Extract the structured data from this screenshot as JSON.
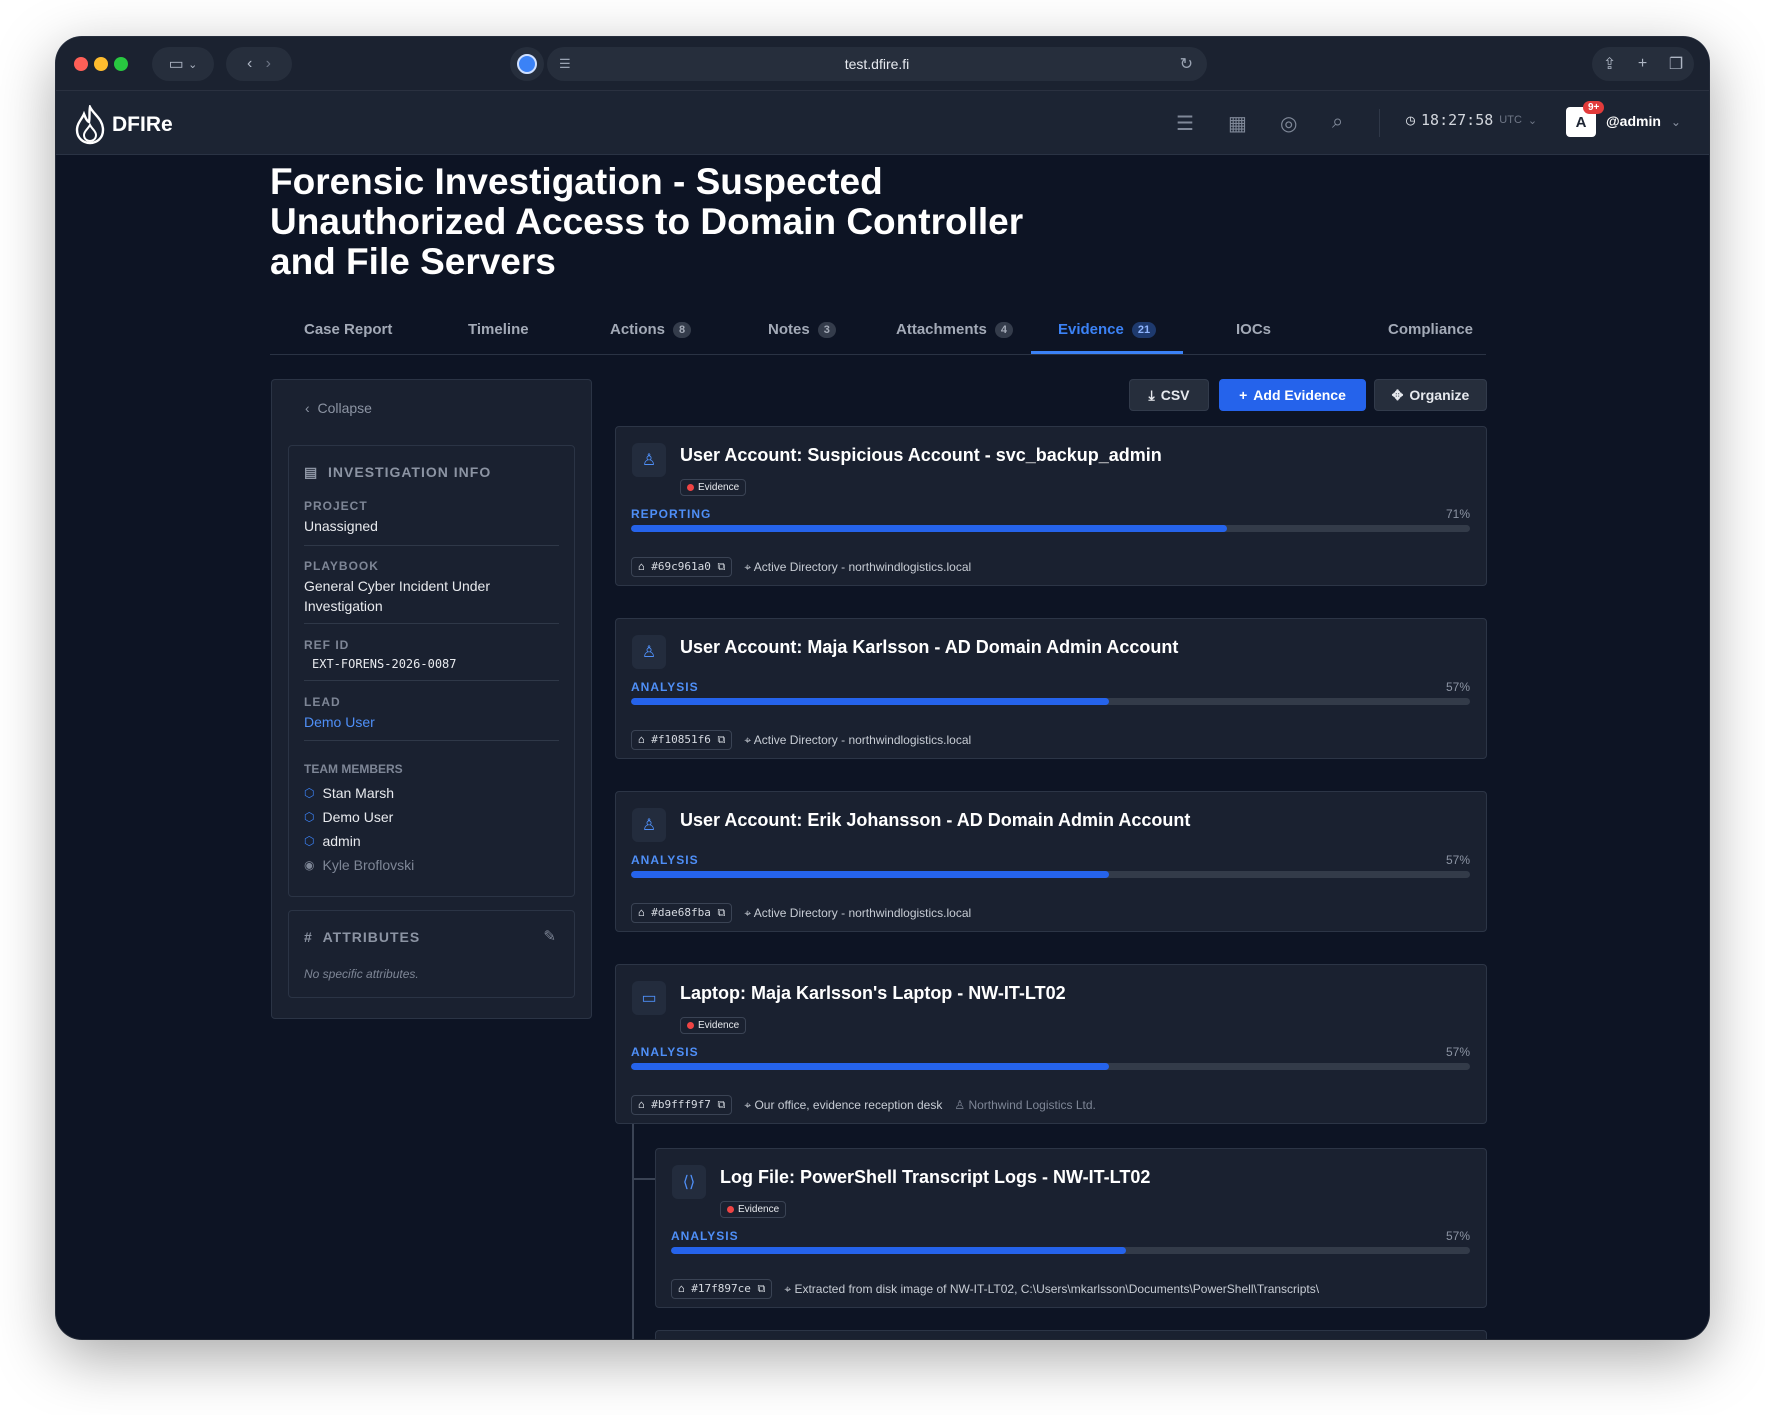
{
  "browser": {
    "url": "test.dfire.fi"
  },
  "header": {
    "app_name": "DFIRe",
    "time": "18:27:58",
    "timezone": "UTC",
    "notif_badge": "9+",
    "avatar_letter": "A",
    "username": "@admin"
  },
  "case": {
    "title": "Forensic Investigation - Suspected Unauthorized Access to Domain Controller and File Servers"
  },
  "tabs": [
    {
      "label": "Case Report",
      "count": ""
    },
    {
      "label": "Timeline",
      "count": ""
    },
    {
      "label": "Actions",
      "count": "8"
    },
    {
      "label": "Notes",
      "count": "3"
    },
    {
      "label": "Attachments",
      "count": "4"
    },
    {
      "label": "Evidence",
      "count": "21"
    },
    {
      "label": "IOCs",
      "count": ""
    },
    {
      "label": "Compliance",
      "count": ""
    }
  ],
  "sidebar": {
    "collapse": "Collapse",
    "info_title": "INVESTIGATION INFO",
    "project_label": "PROJECT",
    "project": "Unassigned",
    "playbook_label": "PLAYBOOK",
    "playbook": "General Cyber Incident Under Investigation",
    "refid_label": "REF ID",
    "refid": "EXT-FORENS-2026-0087",
    "lead_label": "LEAD",
    "lead": "Demo User",
    "team_label": "TEAM MEMBERS",
    "team": [
      "Stan Marsh",
      "Demo User",
      "admin",
      "Kyle Broflovski"
    ],
    "attributes_title": "ATTRIBUTES",
    "attributes_empty": "No specific attributes."
  },
  "toolbar": {
    "csv": "CSV",
    "add": "Add Evidence",
    "organize": "Organize"
  },
  "evidence": [
    {
      "title": "User Account: Suspicious Account - svc_backup_admin",
      "badge": "Evidence",
      "stage": "REPORTING",
      "pct": "71%",
      "progress": 0.71,
      "hash": "#69c961a0",
      "location": "Active Directory - northwindlogistics.local",
      "owner": ""
    },
    {
      "title": "User Account: Maja Karlsson - AD Domain Admin Account",
      "badge": "",
      "stage": "ANALYSIS",
      "pct": "57%",
      "progress": 0.57,
      "hash": "#f10851f6",
      "location": "Active Directory - northwindlogistics.local",
      "owner": ""
    },
    {
      "title": "User Account: Erik Johansson - AD Domain Admin Account",
      "badge": "",
      "stage": "ANALYSIS",
      "pct": "57%",
      "progress": 0.57,
      "hash": "#dae68fba",
      "location": "Active Directory - northwindlogistics.local",
      "owner": ""
    },
    {
      "title": "Laptop: Maja Karlsson's Laptop - NW-IT-LT02",
      "badge": "Evidence",
      "stage": "ANALYSIS",
      "pct": "57%",
      "progress": 0.57,
      "hash": "#b9fff9f7",
      "location": "Our office, evidence reception desk",
      "owner": "Northwind Logistics Ltd."
    },
    {
      "title": "Log File: PowerShell Transcript Logs - NW-IT-LT02",
      "badge": "Evidence",
      "stage": "ANALYSIS",
      "pct": "57%",
      "progress": 0.57,
      "hash": "#17f897ce",
      "location": "Extracted from disk image of NW-IT-LT02, C:\\Users\\mkarlsson\\Documents\\PowerShell\\Transcripts\\",
      "owner": ""
    }
  ]
}
